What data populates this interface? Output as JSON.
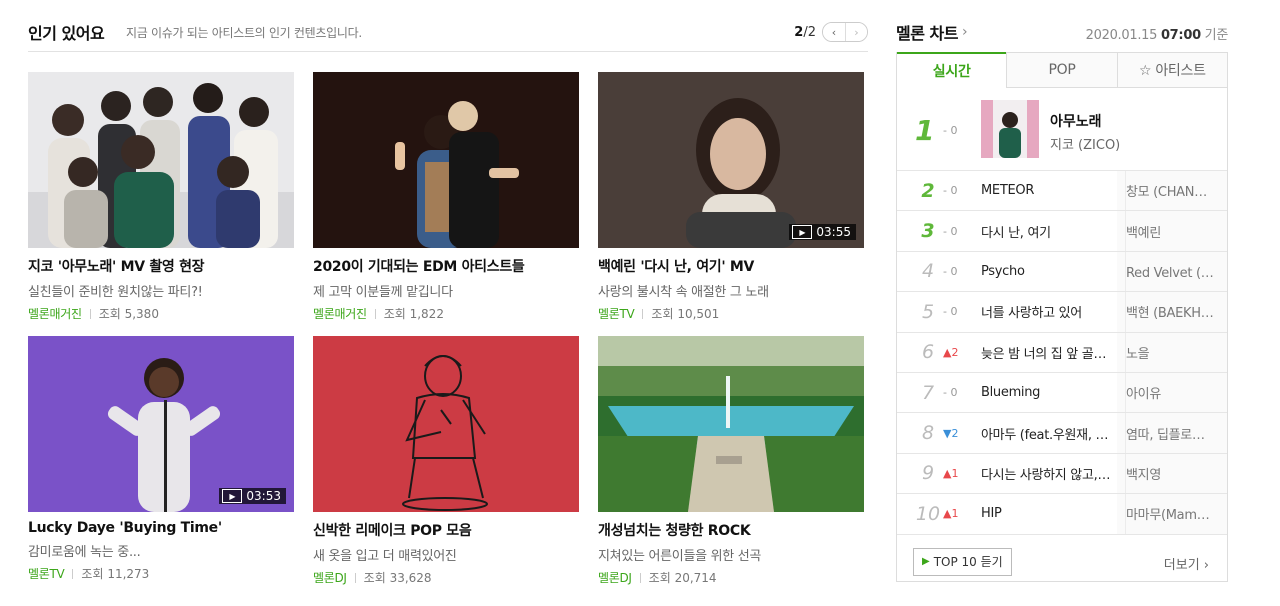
{
  "popular": {
    "title": "인기 있어요",
    "description": "지금 이슈가 되는 아티스트의 인기 컨텐츠입니다.",
    "pager": {
      "current": "2",
      "total": "/2",
      "prev": "‹",
      "next": "›"
    },
    "cards": [
      {
        "title": "지코 '아무노래' MV 촬영 현장",
        "subtitle": "실친들이 준비한 원치않는 파티?!",
        "source": "멜론매거진",
        "views": "조회 5,380",
        "duration": ""
      },
      {
        "title": "2020이 기대되는 EDM 아티스트들",
        "subtitle": "제 고막 이분들께 맡깁니다",
        "source": "멜론매거진",
        "views": "조회 1,822",
        "duration": ""
      },
      {
        "title": "백예린 '다시 난, 여기' MV",
        "subtitle": "사랑의 불시착 속 애절한 그 노래",
        "source": "멜론TV",
        "views": "조회 10,501",
        "duration": "03:55"
      },
      {
        "title": "Lucky Daye 'Buying Time'",
        "subtitle": "감미로움에 녹는 중...",
        "source": "멜론TV",
        "views": "조회 11,273",
        "duration": "03:53"
      },
      {
        "title": "신박한 리메이크 POP 모음",
        "subtitle": "새 옷을 입고 더 매력있어진",
        "source": "멜론DJ",
        "views": "조회 33,628",
        "duration": ""
      },
      {
        "title": "개성넘치는 청량한 ROCK",
        "subtitle": "지쳐있는 어른이들을 위한 선곡",
        "source": "멜론DJ",
        "views": "조회 20,714",
        "duration": ""
      }
    ]
  },
  "chart": {
    "title": "멜론 차트",
    "title_chevron": "›",
    "date": "2020.01.15",
    "time": "07:00",
    "date_suffix": "기준",
    "tabs": [
      "실시간",
      "POP",
      "☆ 아티스트"
    ],
    "top": {
      "rank": "1",
      "change": "- 0",
      "song": "아무노래",
      "artist": "지코 (ZICO)"
    },
    "rows": [
      {
        "rank": "2",
        "change": "- 0",
        "dir": "same",
        "song": "METEOR",
        "artist": "창모 (CHANGMO)"
      },
      {
        "rank": "3",
        "change": "- 0",
        "dir": "same",
        "song": "다시 난, 여기",
        "artist": "백예린"
      },
      {
        "rank": "4",
        "change": "- 0",
        "dir": "same",
        "song": "Psycho",
        "artist": "Red Velvet (레드벨벳)"
      },
      {
        "rank": "5",
        "change": "- 0",
        "dir": "same",
        "song": "너를 사랑하고 있어",
        "artist": "백현 (BAEKHYUN)"
      },
      {
        "rank": "6",
        "change": "▲2",
        "dir": "up",
        "song": "늦은 밤 너의 집 앞 골목길에서",
        "artist": "노을"
      },
      {
        "rank": "7",
        "change": "- 0",
        "dir": "same",
        "song": "Blueming",
        "artist": "아이유"
      },
      {
        "rank": "8",
        "change": "▼2",
        "dir": "down",
        "song": "아마두 (feat.우원재, 김효은, 넉살, Huckleberry P)",
        "artist": "염따, 딥플로우, 팔로알토"
      },
      {
        "rank": "9",
        "change": "▲1",
        "dir": "up",
        "song": "다시는 사랑하지 않고, 이별에 아파하기 싫어",
        "artist": "백지영"
      },
      {
        "rank": "10",
        "change": "▲1",
        "dir": "up",
        "song": "HIP",
        "artist": "마마무(Mamamoo)"
      }
    ],
    "top10_button": "TOP 10 듣기",
    "more": "더보기 ›"
  },
  "colors": {
    "accent": "#3ca61a",
    "up": "#e8484b",
    "down": "#3a8fd8"
  }
}
